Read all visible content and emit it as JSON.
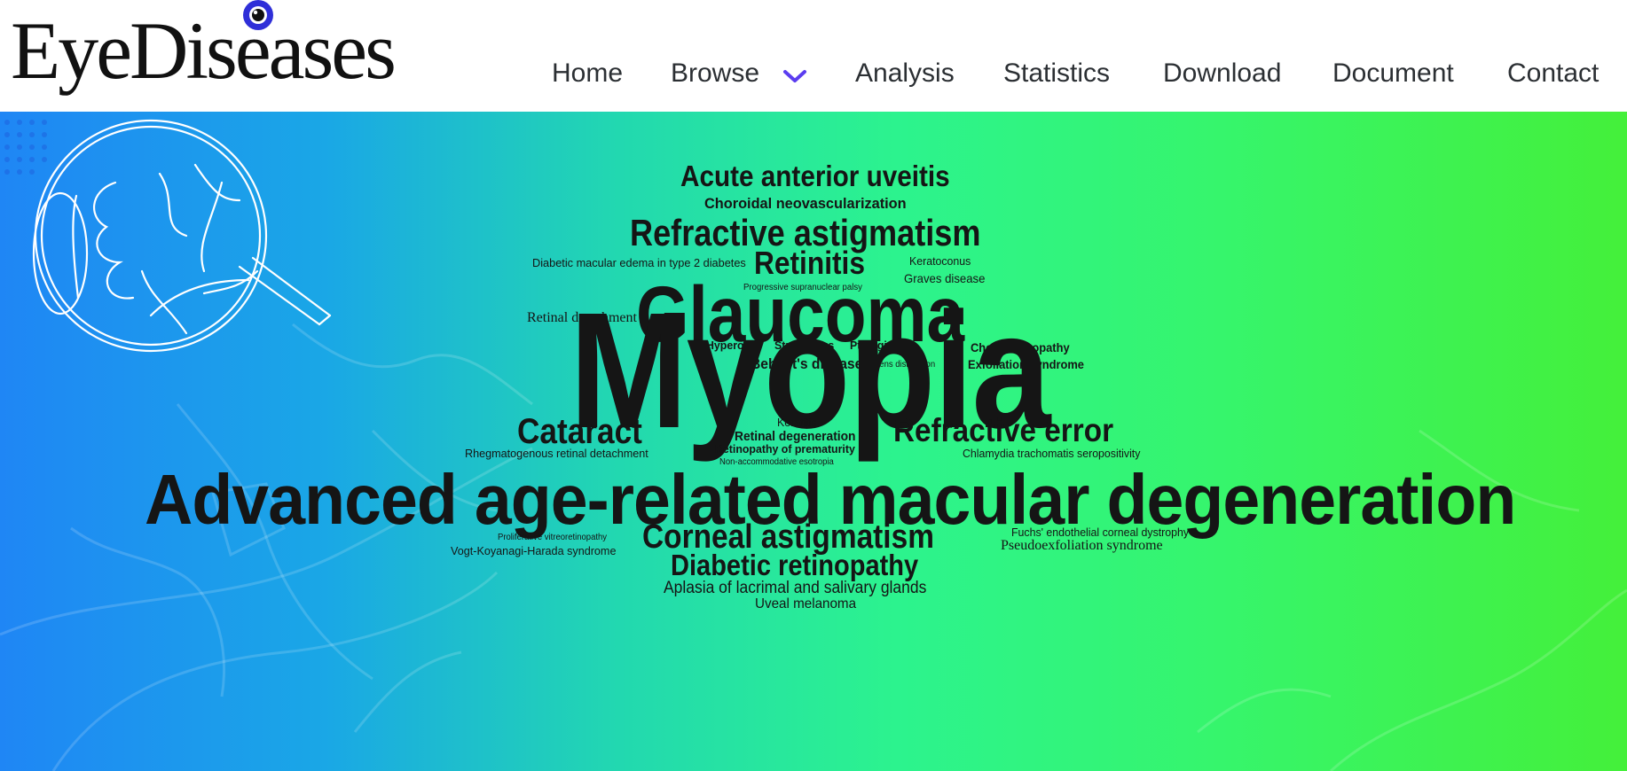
{
  "brand": {
    "logo_text": "EyeDiseases",
    "logo_dot_color": "#2f2fd8"
  },
  "nav": {
    "items": [
      "Home",
      "Browse",
      "Analysis",
      "Statistics",
      "Download",
      "Document",
      "Contact"
    ],
    "browse_chevron_color": "#5b3df0"
  },
  "banner": {
    "gradient_colors": [
      "#1f86f5",
      "#22d8b0",
      "#44f03a"
    ],
    "word_cloud": [
      "Acute anterior uveitis",
      "Choroidal neovascularization",
      "Refractive astigmatism",
      "Diabetic macular edema in type 2 diabetes",
      "Retinitis",
      "Keratoconus",
      "Graves disease",
      "Progressive supranuclear palsy",
      "Retinal detachment",
      "Glaucoma",
      "Hyperopia",
      "Strabismus",
      "Pterygium",
      "Chorioretinopathy",
      "Behcet's disease",
      "Lens dislocation",
      "Exfoliation syndrome",
      "Myopia",
      "Cataract",
      "Keratitis",
      "Retinal degeneration",
      "Refractive error",
      "Rhegmatogenous retinal detachment",
      "Retinopathy of prematurity",
      "Chlamydia trachomatis seropositivity",
      "Non-accommodative esotropia",
      "Advanced age-related macular degeneration",
      "Proliferative vitreoretinopathy",
      "Corneal astigmatism",
      "Fuchs' endothelial corneal dystrophy",
      "Vogt-Koyanagi-Harada syndrome",
      "Pseudoexfoliation syndrome",
      "Diabetic retinopathy",
      "Aplasia of lacrimal and salivary glands",
      "Uveal melanoma"
    ]
  }
}
